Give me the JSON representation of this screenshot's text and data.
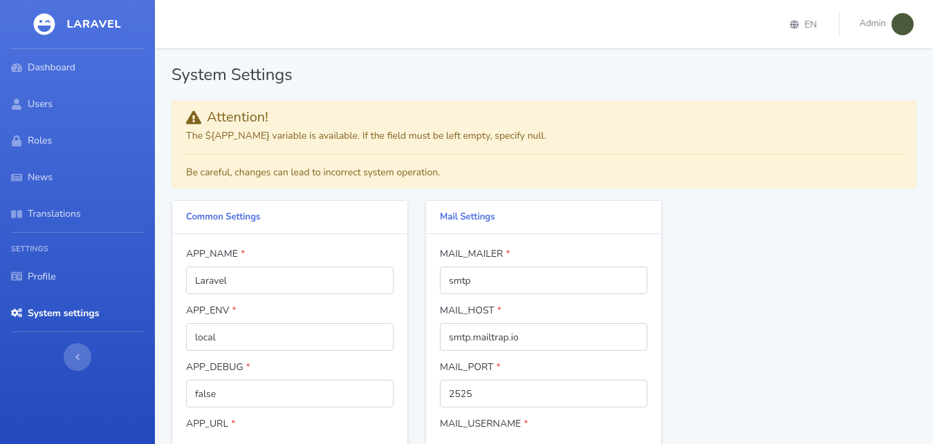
{
  "brand": {
    "name": "LARAVEL"
  },
  "sidebar": {
    "main": [
      {
        "label": "Dashboard",
        "selected": false
      },
      {
        "label": "Users",
        "selected": false
      },
      {
        "label": "Roles",
        "selected": false
      },
      {
        "label": "News",
        "selected": false
      },
      {
        "label": "Translations",
        "selected": false
      }
    ],
    "settings_heading": "SETTINGS",
    "settings": [
      {
        "label": "Profile",
        "selected": false
      },
      {
        "label": "System settings",
        "selected": true
      }
    ]
  },
  "topbar": {
    "language": "EN",
    "user": "Admin"
  },
  "page_title": "System Settings",
  "alert": {
    "title": "Attention!",
    "lines": [
      "The ${APP_NAME} variable is available. If the field must be left empty, specify null.",
      "Be careful, changes can lead to incorrect system operation."
    ]
  },
  "cards": [
    {
      "title": "Common Settings",
      "fields": [
        {
          "label": "APP_NAME",
          "required_mark": "*",
          "value": "Laravel"
        },
        {
          "label": "APP_ENV",
          "required_mark": "*",
          "value": "local"
        },
        {
          "label": "APP_DEBUG",
          "required_mark": "*",
          "value": "false"
        },
        {
          "label": "APP_URL",
          "required_mark": "*"
        }
      ]
    },
    {
      "title": "Mail Settings",
      "fields": [
        {
          "label": "MAIL_MAILER",
          "required_mark": "*",
          "value": "smtp"
        },
        {
          "label": "MAIL_HOST",
          "required_mark": "*",
          "value": "smtp.mailtrap.io"
        },
        {
          "label": "MAIL_PORT",
          "required_mark": "*",
          "value": "2525"
        },
        {
          "label": "MAIL_USERNAME",
          "required_mark": "*"
        }
      ]
    }
  ]
}
